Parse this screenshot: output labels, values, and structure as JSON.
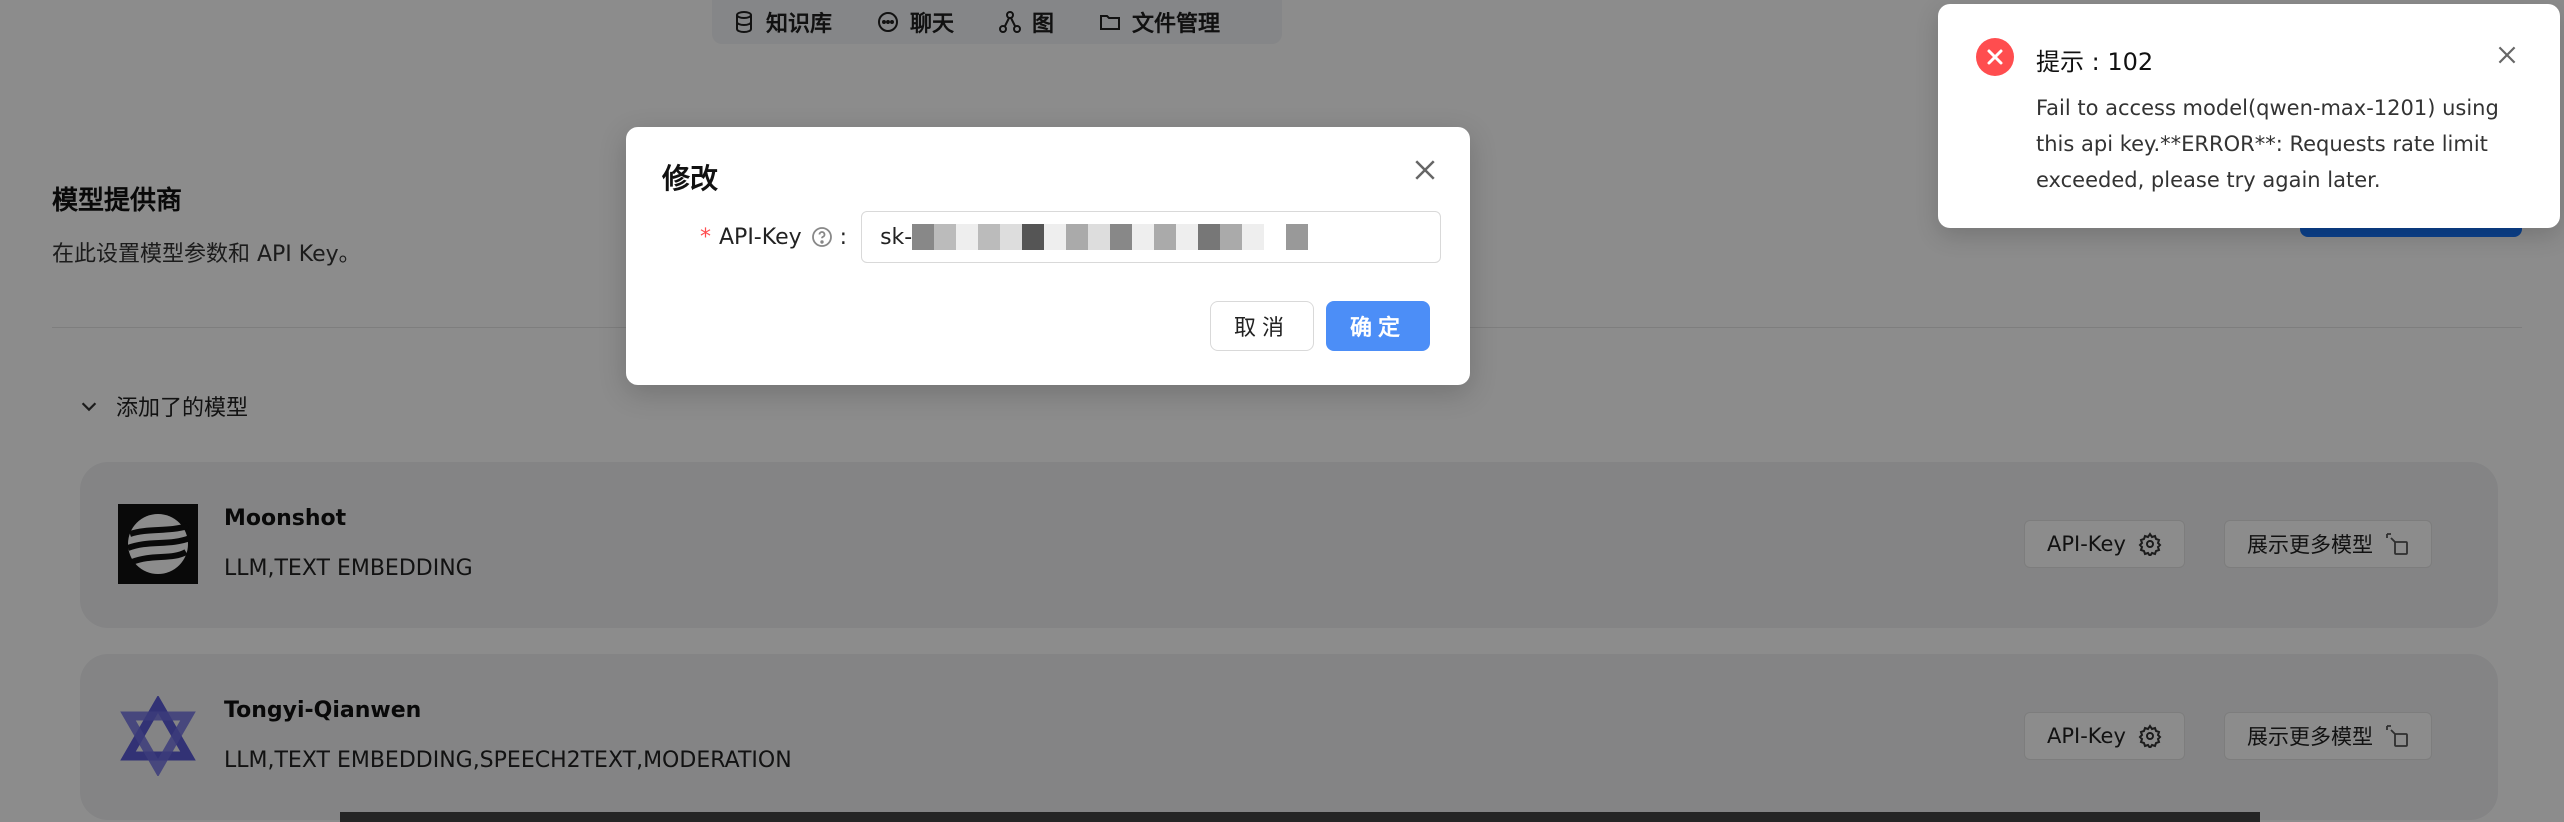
{
  "topnav": {
    "items": [
      {
        "label": "知识库",
        "icon": "database-icon"
      },
      {
        "label": "聊天",
        "icon": "chat-icon"
      },
      {
        "label": "图",
        "icon": "graph-icon"
      },
      {
        "label": "文件管理",
        "icon": "folder-icon"
      }
    ]
  },
  "section": {
    "title": "模型提供商",
    "description": "在此设置模型参数和 API Key。"
  },
  "added_models": {
    "label": "添加了的模型",
    "cards": [
      {
        "name": "Moonshot",
        "tags": "LLM,TEXT EMBEDDING",
        "api_key_label": "API-Key",
        "more_label": "展示更多模型",
        "logo": "moonshot-logo"
      },
      {
        "name": "Tongyi-Qianwen",
        "tags": "LLM,TEXT EMBEDDING,SPEECH2TEXT,MODERATION",
        "api_key_label": "API-Key",
        "more_label": "展示更多模型",
        "logo": "tongyi-logo"
      }
    ]
  },
  "modal": {
    "title": "修改",
    "field_label": "API-Key",
    "field_value_prefix": "sk-",
    "cancel_label": "取消",
    "ok_label": "确定"
  },
  "notification": {
    "title": "提示 : 102",
    "message": "Fail to access model(qwen-max-1201) using this api key.**ERROR**: Requests rate limit exceeded, please try again later.",
    "status_color": "#ff4d4f"
  },
  "colors": {
    "primary": "#1677ff",
    "error": "#ff4d4f"
  }
}
